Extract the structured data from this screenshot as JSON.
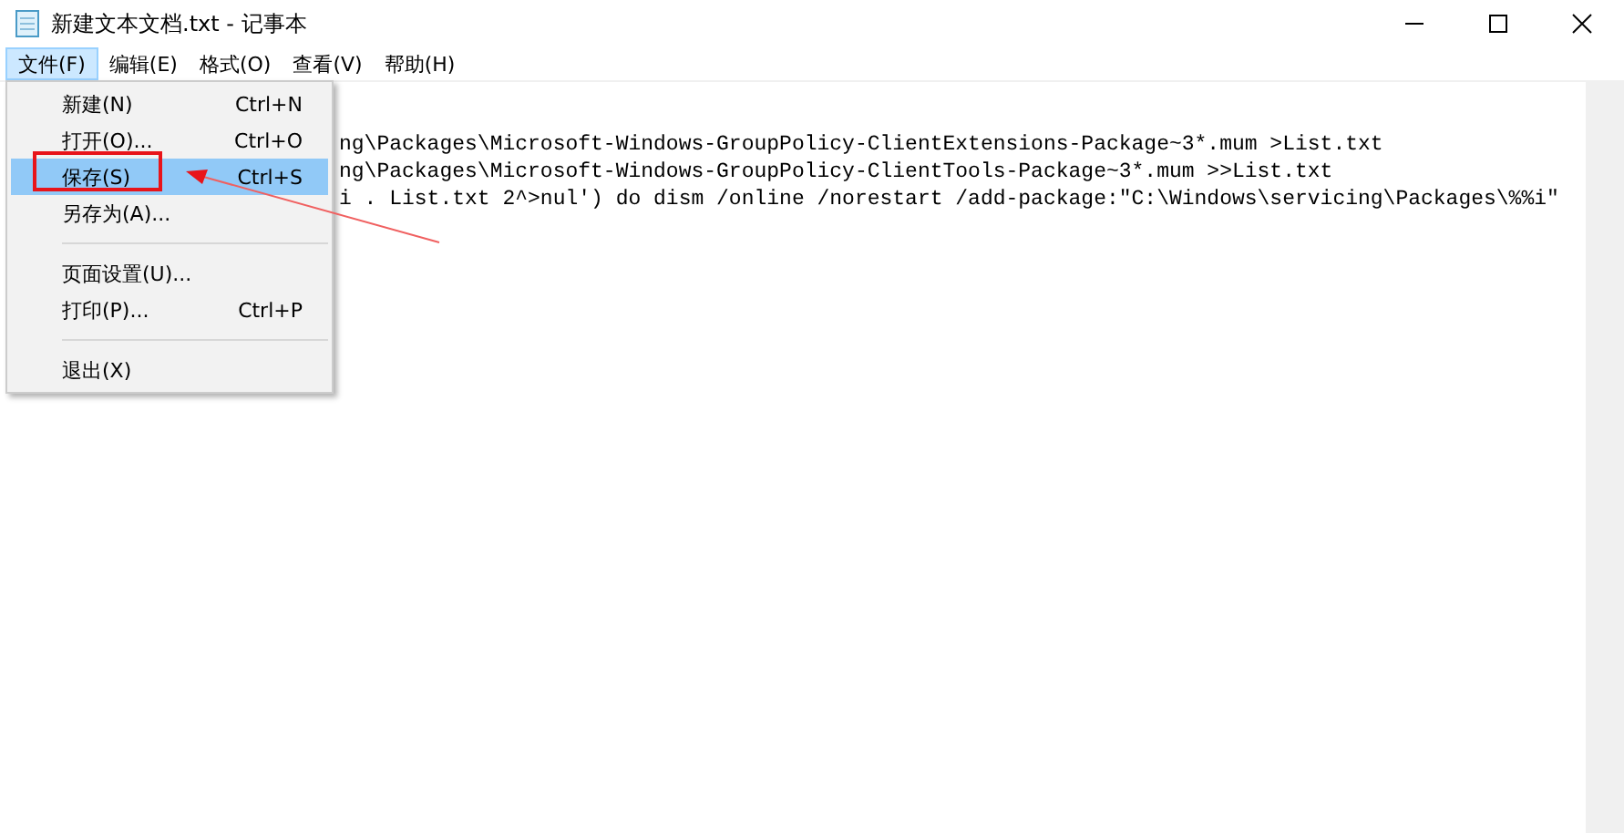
{
  "window": {
    "title": "新建文本文档.txt - 记事本"
  },
  "menu_bar": [
    {
      "label": "文件(F)",
      "selected": true
    },
    {
      "label": "编辑(E)",
      "selected": false
    },
    {
      "label": "格式(O)",
      "selected": false
    },
    {
      "label": "查看(V)",
      "selected": false
    },
    {
      "label": "帮助(H)",
      "selected": false
    }
  ],
  "file_menu": [
    {
      "kind": "item",
      "label": "新建(N)",
      "shortcut": "Ctrl+N",
      "selected": false
    },
    {
      "kind": "item",
      "label": "打开(O)...",
      "shortcut": "Ctrl+O",
      "selected": false
    },
    {
      "kind": "item",
      "label": "保存(S)",
      "shortcut": "Ctrl+S",
      "selected": true
    },
    {
      "kind": "item",
      "label": "另存为(A)...",
      "selected": false
    },
    {
      "kind": "separator"
    },
    {
      "kind": "item",
      "label": "页面设置(U)...",
      "selected": false
    },
    {
      "kind": "item",
      "label": "打印(P)...",
      "shortcut": "Ctrl+P",
      "selected": false
    },
    {
      "kind": "separator"
    },
    {
      "kind": "item",
      "label": "退出(X)",
      "selected": false
    }
  ],
  "editor_lines": [
    {
      "text": "ng\\Packages\\Microsoft-Windows-GroupPolicy-ClientExtensions-Package~3*.mum >List.txt"
    },
    {
      "text": "ng\\Packages\\Microsoft-Windows-GroupPolicy-ClientTools-Package~3*.mum >>List.txt"
    },
    {
      "text": "i . List.txt 2^>nul') do dism /online /norestart /add-package:\"C:\\Windows\\servicing\\Packages\\%%i\""
    }
  ]
}
